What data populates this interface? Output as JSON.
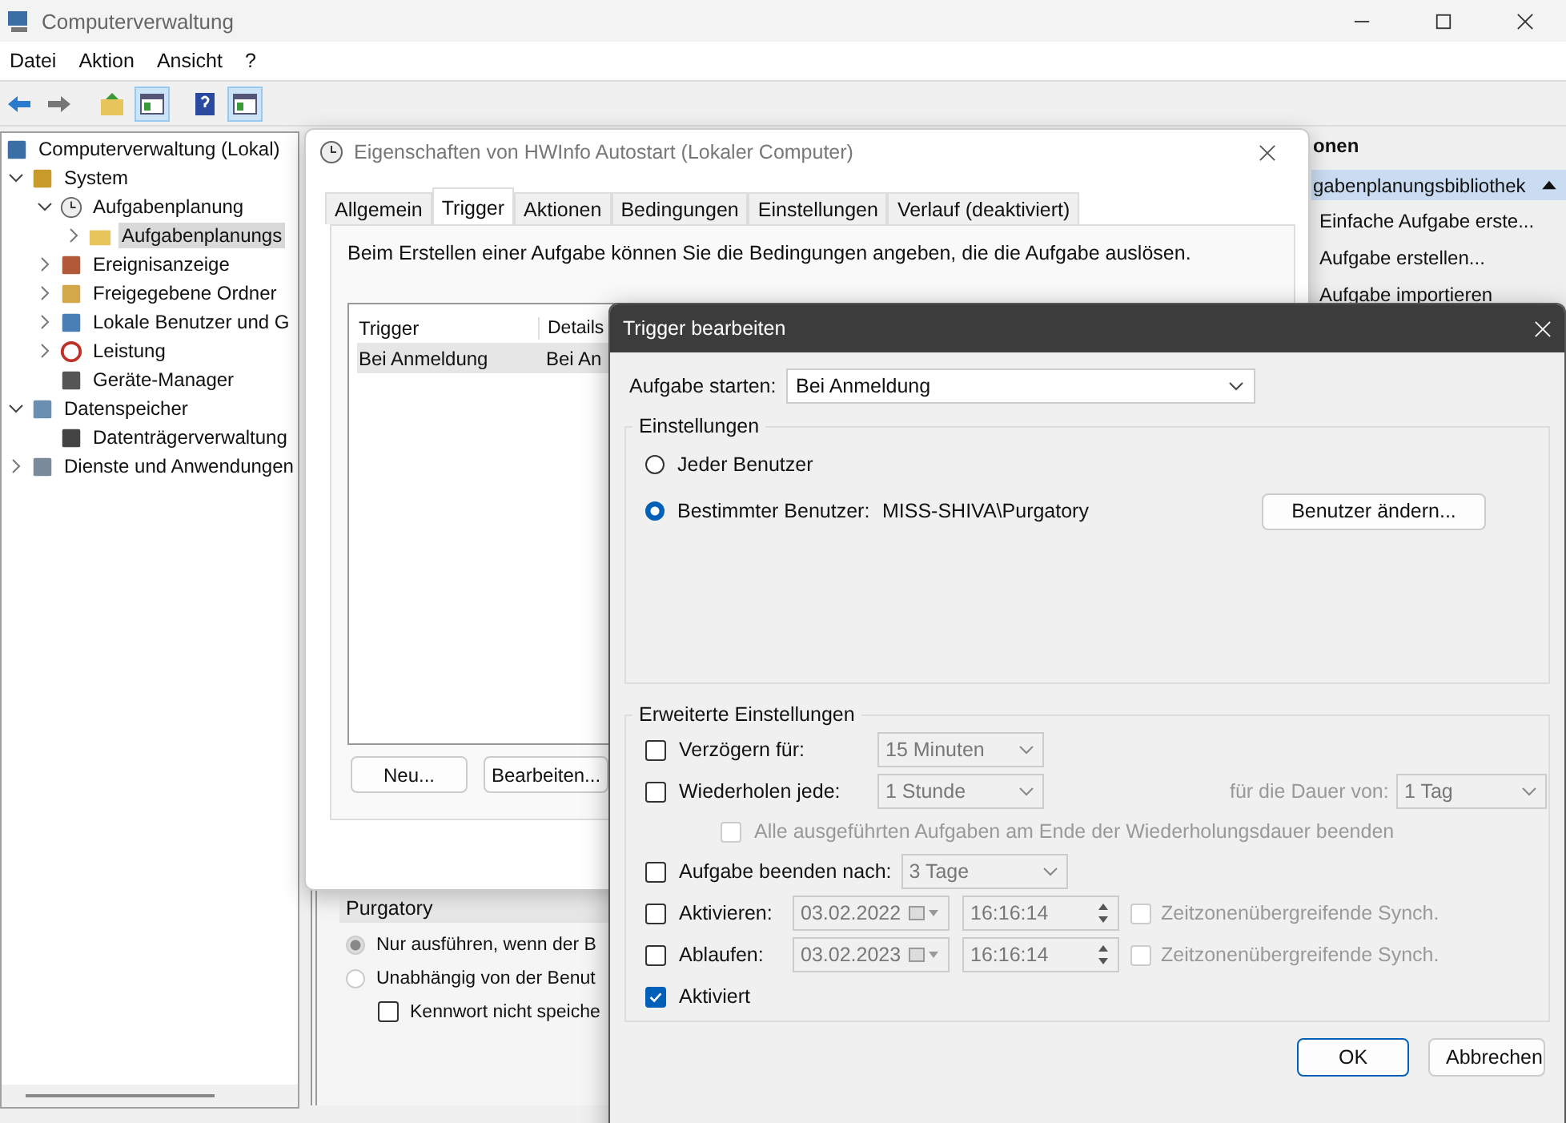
{
  "main_window": {
    "title": "Computerverwaltung",
    "menu": [
      "Datei",
      "Aktion",
      "Ansicht",
      "?"
    ],
    "toolbar": [
      {
        "kind": "back",
        "selected": false
      },
      {
        "kind": "forward",
        "selected": false
      },
      {
        "kind": "up",
        "selected": false
      },
      {
        "kind": "tree",
        "selected": true
      },
      {
        "kind": "help",
        "selected": false
      },
      {
        "kind": "pane",
        "selected": true
      }
    ],
    "tree": [
      {
        "label": "Computerverwaltung (Lokal)",
        "kind": "computer",
        "selected": false,
        "children": [
          {
            "label": "System",
            "kind": "tools",
            "expanded": true,
            "selected": false,
            "children": [
              {
                "label": "Aufgabenplanung",
                "kind": "clock",
                "expanded": true,
                "selected": false,
                "children": [
                  {
                    "label": "Aufgabenplanungs",
                    "kind": "folder",
                    "expanded": false,
                    "selected": true
                  }
                ]
              },
              {
                "label": "Ereignisanzeige",
                "kind": "log",
                "expanded": false,
                "selected": false
              },
              {
                "label": "Freigegebene Ordner",
                "kind": "share",
                "expanded": false,
                "selected": false
              },
              {
                "label": "Lokale Benutzer und G",
                "kind": "users",
                "expanded": false,
                "selected": false
              },
              {
                "label": "Leistung",
                "kind": "gauge",
                "expanded": false,
                "selected": false
              },
              {
                "label": "Geräte-Manager",
                "kind": "device",
                "selected": false
              }
            ]
          },
          {
            "label": "Datenspeicher",
            "kind": "storage",
            "expanded": true,
            "selected": false,
            "children": [
              {
                "label": "Datenträgerverwaltung",
                "kind": "disk",
                "selected": false
              }
            ]
          },
          {
            "label": "Dienste und Anwendungen",
            "kind": "services",
            "expanded": false,
            "selected": false
          }
        ]
      }
    ],
    "actions_pane": {
      "header": "onen",
      "section": {
        "label": "gabenplanungsbibliothek",
        "expanded": true
      },
      "items": [
        "Einfache Aufgabe erste...",
        "Aufgabe erstellen...",
        "Aufgabe importieren"
      ]
    }
  },
  "properties_dialog": {
    "title": "Eigenschaften von HWInfo Autostart (Lokaler Computer)",
    "tabs": [
      {
        "label": "Allgemein",
        "selected": false
      },
      {
        "label": "Trigger",
        "selected": true
      },
      {
        "label": "Aktionen",
        "selected": false
      },
      {
        "label": "Bedingungen",
        "selected": false
      },
      {
        "label": "Einstellungen",
        "selected": false
      },
      {
        "label": "Verlauf (deaktiviert)",
        "selected": false
      }
    ],
    "description": "Beim Erstellen einer Aufgabe können Sie die Bedingungen angeben, die die Aufgabe auslösen.",
    "table": {
      "columns": [
        "Trigger",
        "Details"
      ],
      "rows": [
        {
          "cells": [
            "Bei Anmeldung",
            "Bei An"
          ],
          "selected": true
        }
      ]
    },
    "buttons": [
      "Neu...",
      "Bearbeiten..."
    ]
  },
  "background_window": {
    "heading": "Purgatory",
    "options": [
      {
        "kind": "radio",
        "label": "Nur ausführen, wenn der B",
        "checked": true
      },
      {
        "kind": "radio",
        "label": "Unabhängig von der Benut",
        "checked": false
      },
      {
        "kind": "checkbox",
        "label": "Kennwort nicht speiche",
        "checked": false
      }
    ]
  },
  "trigger_dialog": {
    "title": "Trigger bearbeiten",
    "start": {
      "label": "Aufgabe starten:",
      "value": "Bei Anmeldung"
    },
    "settings": {
      "title": "Einstellungen",
      "options": [
        {
          "label": "Jeder Benutzer",
          "selected": false
        },
        {
          "label": "Bestimmter Benutzer:",
          "selected": true,
          "user": "MISS-SHIVA\\Purgatory"
        }
      ],
      "button": "Benutzer ändern..."
    },
    "advanced": {
      "title": "Erweiterte Einstellungen",
      "rows": [
        {
          "kind": "combo",
          "label": "Verzögern für:",
          "checked": false,
          "value": "15 Minuten",
          "disabled": true
        },
        {
          "kind": "repeat",
          "label": "Wiederholen jede:",
          "checked": false,
          "value": "1 Stunde",
          "duration_label": "für die Dauer von:",
          "duration": "1 Tag",
          "disabled": true
        },
        {
          "kind": "sub",
          "label": "Alle ausgeführten Aufgaben am Ende der Wiederholungsdauer beenden",
          "checked": false,
          "disabled": true
        },
        {
          "kind": "combo",
          "label": "Aufgabe beenden nach:",
          "checked": false,
          "value": "3 Tage",
          "disabled": true
        },
        {
          "kind": "datetime",
          "label": "Aktivieren:",
          "checked": false,
          "date": "03.02.2022",
          "time": "16:16:14",
          "sync_label": "Zeitzonenübergreifende Synch.",
          "sync_checked": false,
          "disabled": true
        },
        {
          "kind": "datetime",
          "label": "Ablaufen:",
          "checked": false,
          "date": "03.02.2023",
          "time": "16:16:14",
          "sync_label": "Zeitzonenübergreifende Synch.",
          "sync_checked": false,
          "disabled": true
        },
        {
          "kind": "check",
          "label": "Aktiviert",
          "checked": true,
          "disabled": false
        }
      ]
    },
    "buttons": [
      {
        "label": "OK",
        "default": true
      },
      {
        "label": "Abbrechen",
        "default": false
      }
    ]
  }
}
